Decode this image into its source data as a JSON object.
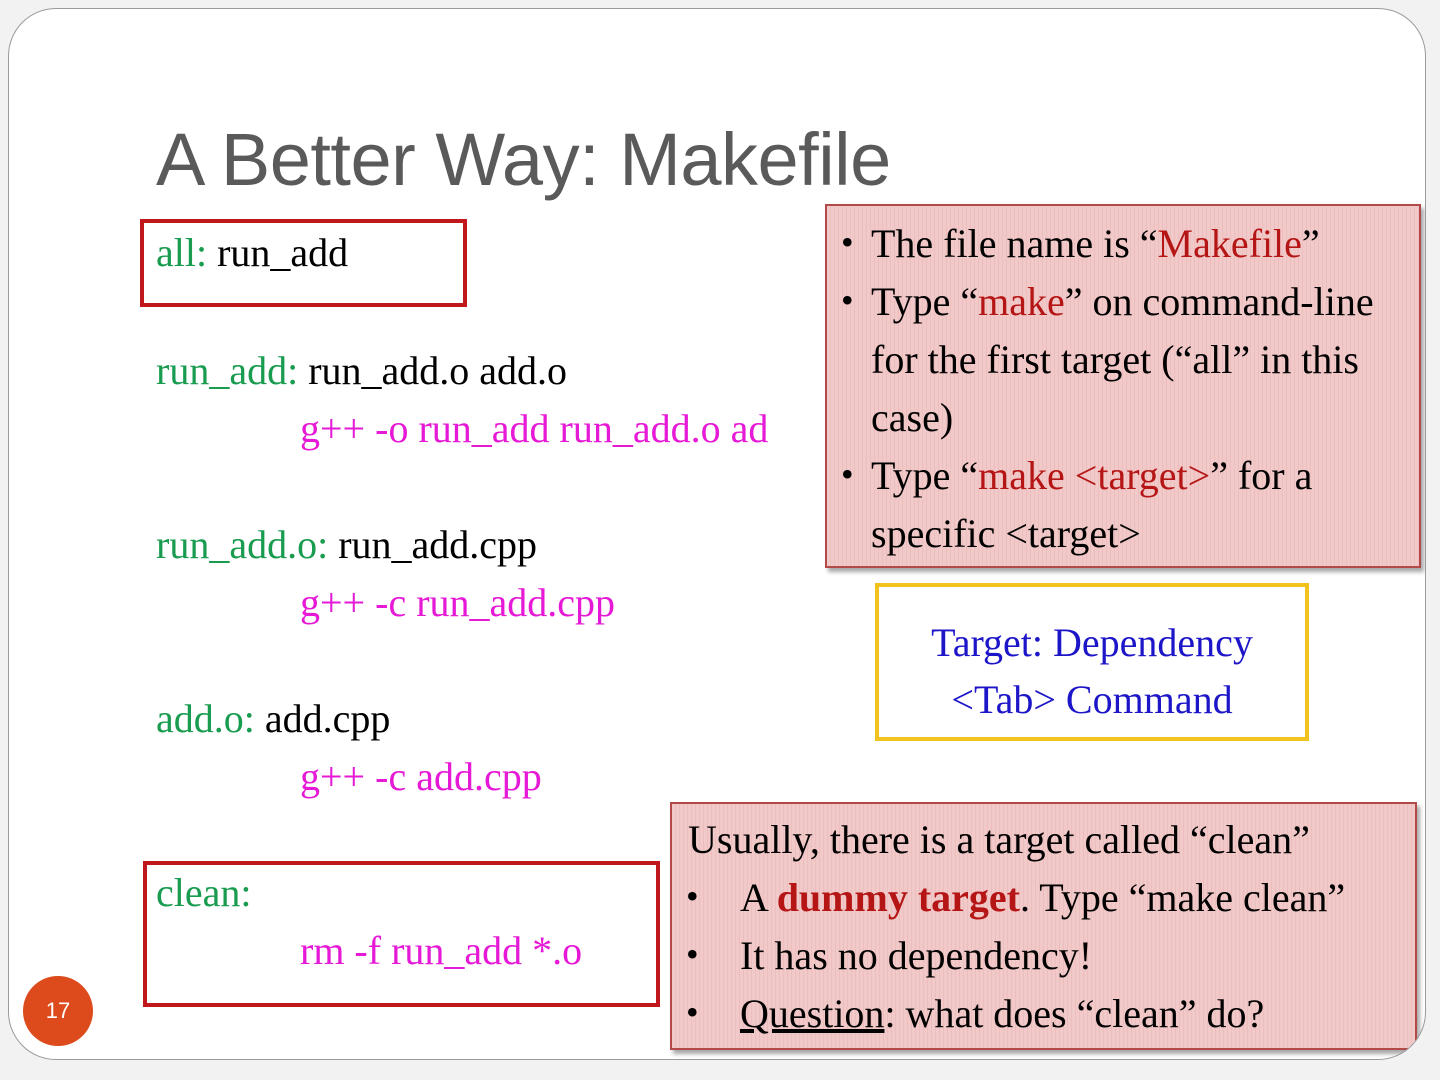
{
  "slide": {
    "title": "A Better Way: Makefile",
    "page_number": "17"
  },
  "makefile": {
    "all_target": "all:",
    "all_dep": " run_add",
    "run_add_target": "run_add:",
    "run_add_deps": " run_add.o add.o",
    "run_add_cmd": "g++ -o run_add run_add.o ad",
    "run_add_o_target": "run_add.o:",
    "run_add_o_dep": " run_add.cpp",
    "run_add_o_cmd": "g++ -c run_add.cpp",
    "add_o_target": "add.o:",
    "add_o_dep": " add.cpp",
    "add_o_cmd": "g++ -c add.cpp",
    "clean_target": "clean:",
    "clean_cmd": "rm -f  run_add   *.o"
  },
  "note_top": {
    "bullet": "•",
    "b1_pre": "The file name is “",
    "b1_hl": "Makefile",
    "b1_post": "”",
    "b2_pre": "Type “",
    "b2_hl": "make",
    "b2_post": "” on command-line",
    "b2_line2": "for the first target (“all” in this",
    "b2_line3": "case)",
    "b3_pre": "Type “",
    "b3_hl": "make <target>",
    "b3_post": "” for a",
    "b3_line2": "specific <target>"
  },
  "legend_box": {
    "line1": "Target: Dependency",
    "line2": "<Tab> Command"
  },
  "note_bottom": {
    "intro": "Usually, there is a target called “clean”",
    "bullet": "•",
    "b1_pre": "A ",
    "b1_bold": "dummy target",
    "b1_post": ". Type “make clean”",
    "b2": "It has no dependency!",
    "b3_u": "Question",
    "b3_post": ": what does “clean” do?"
  },
  "colors": {
    "target": "#1a9c50",
    "dependency": "#000000",
    "command": "#e619d6",
    "highlight_box": "#c0171d",
    "note_bg": "#f2c9c9",
    "legend_border": "#f2c31c",
    "legend_text": "#1d16c9",
    "page_badge": "#dd4a1c"
  }
}
